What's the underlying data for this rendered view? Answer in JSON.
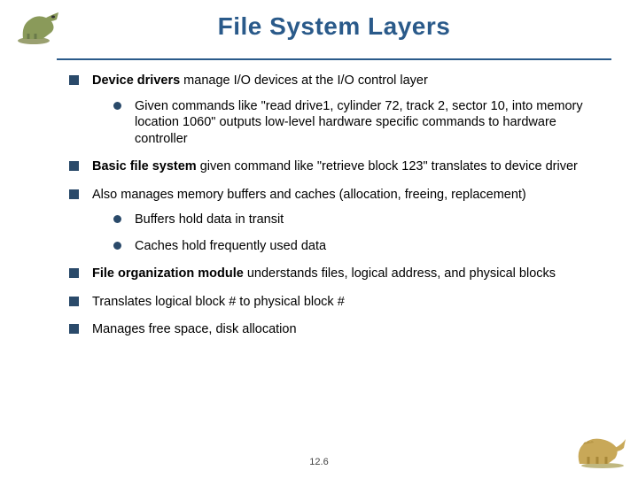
{
  "title": "File System Layers",
  "bullets": {
    "b1_bold": "Device drivers",
    "b1_rest": " manage I/O devices at the I/O control layer",
    "b1a": "Given commands like \"read drive1, cylinder 72, track 2, sector 10, into memory location 1060\" outputs low-level hardware specific commands to hardware controller",
    "b2_bold": "Basic file system",
    "b2_rest": " given command like \"retrieve block 123\" translates to device driver",
    "b3": "Also manages memory buffers and caches (allocation, freeing, replacement)",
    "b3a": "Buffers hold data in transit",
    "b3b": "Caches hold frequently used data",
    "b4_bold": "File organization module",
    "b4_rest": " understands files, logical address, and physical blocks",
    "b5": "Translates logical block # to physical block #",
    "b6": "Manages free space, disk allocation"
  },
  "footer": "12.6"
}
